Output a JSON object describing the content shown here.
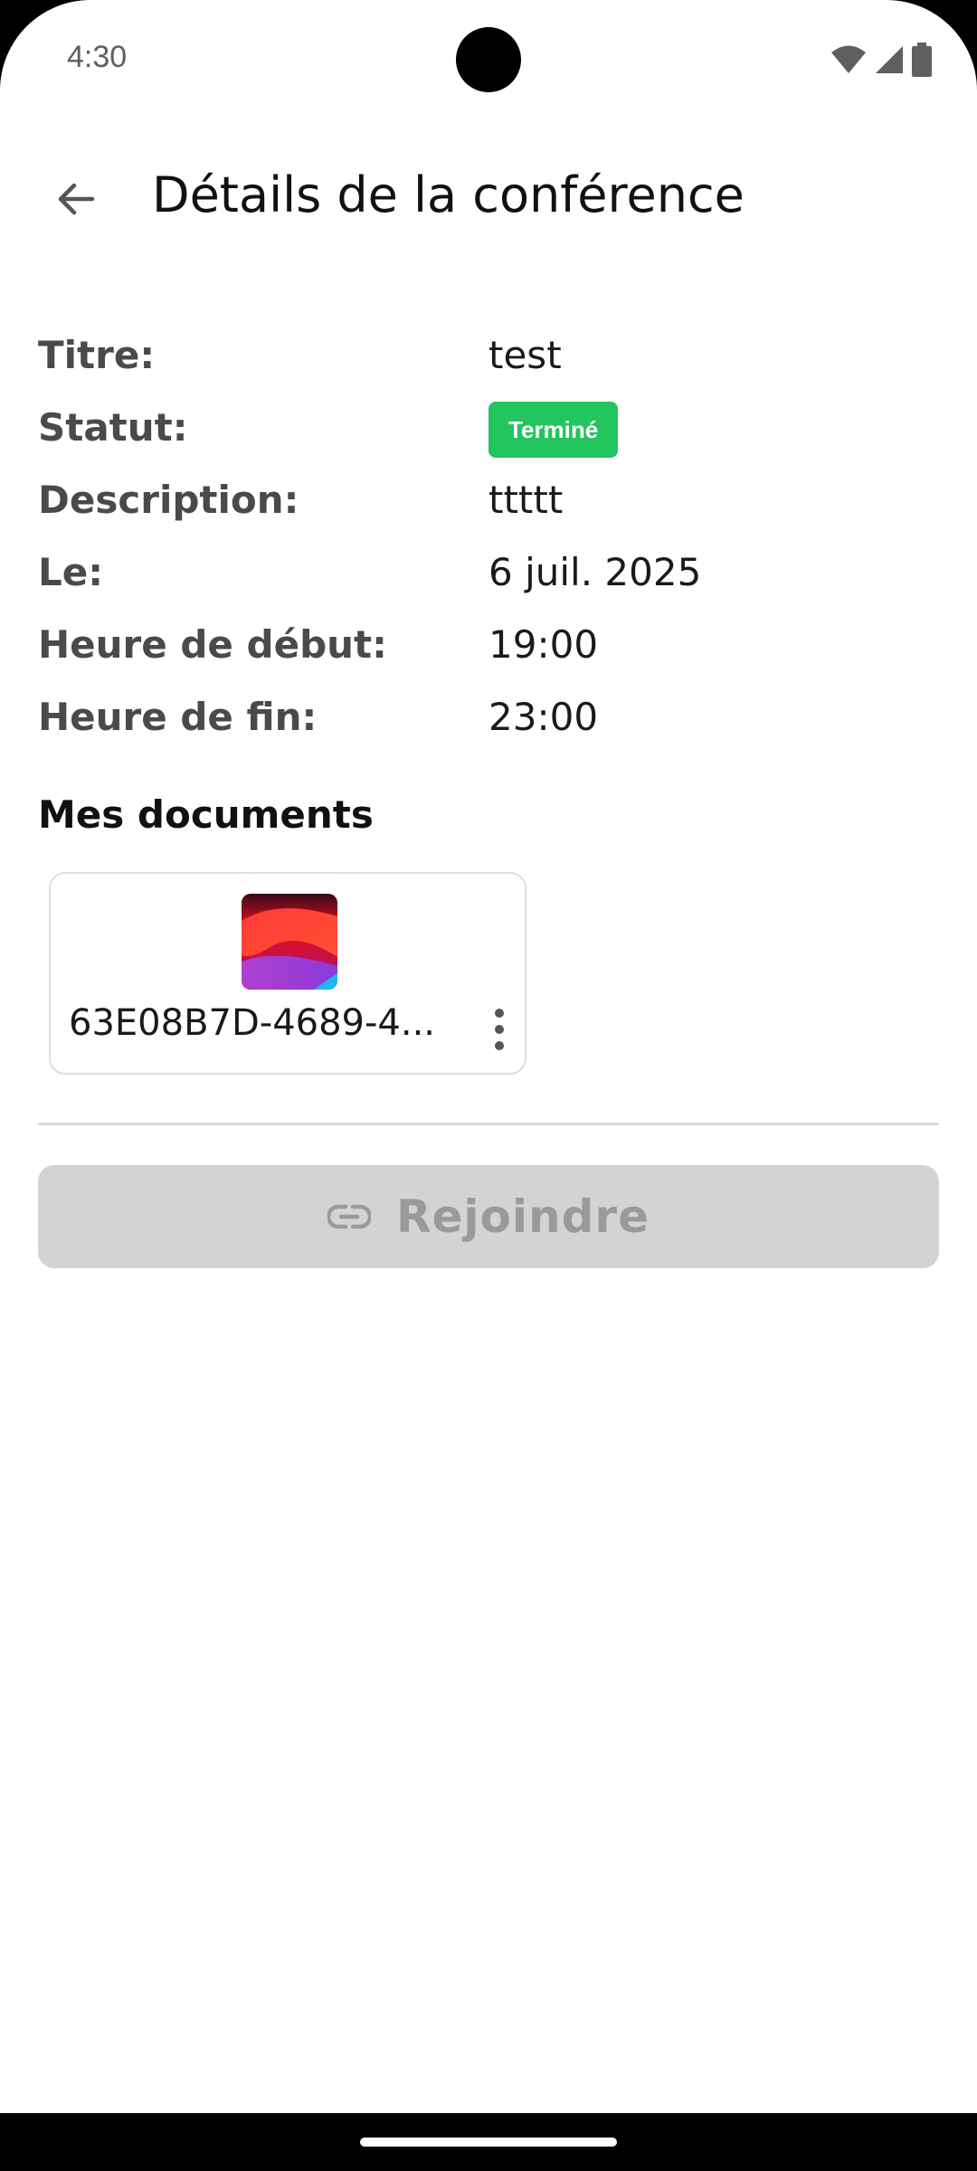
{
  "status_bar": {
    "time": "4:30",
    "icons": [
      "wifi-icon",
      "signal-icon",
      "battery-icon"
    ]
  },
  "header": {
    "title": "Détails de la conférence",
    "back_icon": "arrow-back-icon"
  },
  "details": {
    "title_label": "Titre:",
    "title_value": "test",
    "status_label": "Statut:",
    "status_value": "Terminé",
    "description_label": "Description:",
    "description_value": "ttttt",
    "date_label": "Le:",
    "date_value": "6 juil. 2025",
    "start_label": "Heure de début:",
    "start_value": "19:00",
    "end_label": "Heure de fin:",
    "end_value": "23:00"
  },
  "documents": {
    "section_title": "Mes documents",
    "items": [
      {
        "name": "63E08B7D-4689-4...",
        "menu_icon": "more-vert-icon"
      }
    ]
  },
  "actions": {
    "join_label": "Rejoindre",
    "join_icon": "link-icon"
  },
  "colors": {
    "status_badge": "#22c55e",
    "join_button_disabled": "#d3d3d3"
  }
}
